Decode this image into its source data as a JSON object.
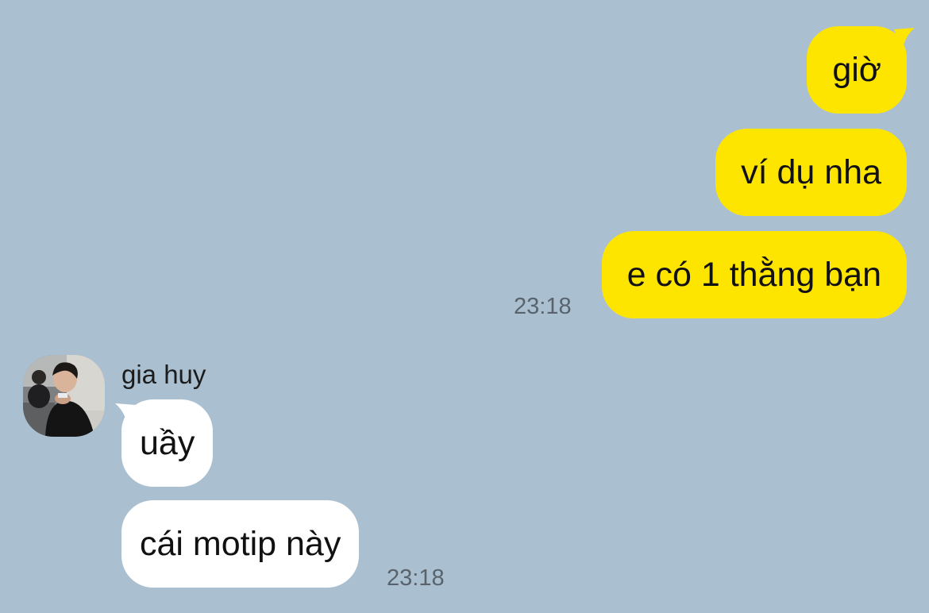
{
  "outgoing": [
    {
      "text": "giờ"
    },
    {
      "text": "ví dụ nha"
    },
    {
      "text": "e có 1 thằng bạn",
      "time": "23:18"
    }
  ],
  "incoming": {
    "sender": "gia huy",
    "messages": [
      {
        "text": "uầy"
      },
      {
        "text": "cái motip này",
        "time": "23:18"
      }
    ]
  },
  "colors": {
    "background": "#aac0d1",
    "outgoing_bubble": "#fee500",
    "incoming_bubble": "#ffffff",
    "timestamp": "#5a636b"
  },
  "icons": {
    "avatar": "profile-photo-avatar"
  }
}
